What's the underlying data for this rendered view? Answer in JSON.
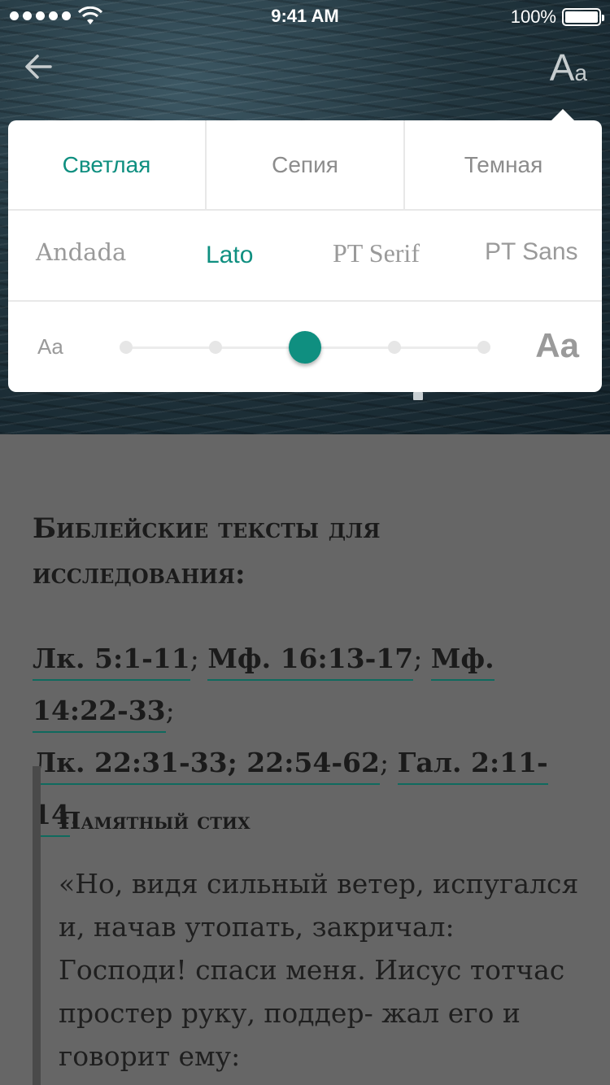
{
  "status_bar": {
    "time": "9:41 AM",
    "battery": "100%"
  },
  "nav": {
    "back_icon": "arrow-left-icon",
    "font_settings_big": "A",
    "font_settings_small": "a"
  },
  "popover": {
    "themes": [
      {
        "label": "Светлая",
        "active": true
      },
      {
        "label": "Сепия",
        "active": false
      },
      {
        "label": "Темная",
        "active": false
      }
    ],
    "fonts": [
      {
        "label": "Andada",
        "active": false
      },
      {
        "label": "Lato",
        "active": true
      },
      {
        "label": "PT Serif",
        "active": false
      },
      {
        "label": "PT Sans",
        "active": false
      }
    ],
    "size": {
      "small_label": "Aa",
      "large_label": "Aa",
      "steps": 5,
      "selected_step": 3
    },
    "accent_color": "#0f8f80"
  },
  "content": {
    "heading": "Библейские тексты для исследования:",
    "references": [
      {
        "text": "Лк. 5:1-11",
        "after": "; "
      },
      {
        "text": "Мф. 16:13-17",
        "after": "; "
      },
      {
        "text": "Мф. 14:22-33",
        "after": ";"
      },
      {
        "text": "Лк. 22:31-33; 22:54-62",
        "after": "; "
      },
      {
        "text": "Гал. 2:11-14",
        "after": "."
      }
    ],
    "memory_verse": {
      "title": "Памятный стих",
      "text": "«Но, видя сильный ветер, испугался и, начав утопать, закричал: Господи! спаси меня. Иисус тотчас простер руку, поддер- жал его и говорит ему:"
    }
  }
}
